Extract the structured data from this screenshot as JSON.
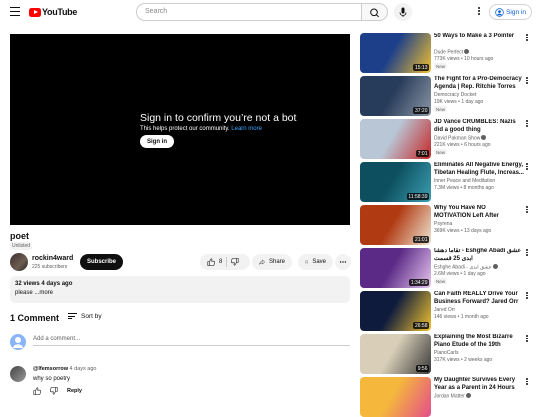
{
  "header": {
    "logo_text": "YouTube",
    "search_placeholder": "Search",
    "signin_label": "Sign in"
  },
  "player": {
    "message": "Sign in to confirm you’re not a bot",
    "sub": "This helps protect our community.",
    "learn_more": "Learn more",
    "button": "Sign in"
  },
  "video": {
    "title": "poet",
    "visibility": "Unlisted",
    "channel": "rockin4ward",
    "subscribers": "225 subscribers",
    "subscribe_label": "Subscribe",
    "likes": "8",
    "share_label": "Share",
    "save_label": "Save",
    "views_date": "32 views  4 days ago",
    "description": "please ...more"
  },
  "comments": {
    "count": "1 Comment",
    "sort_label": "Sort by",
    "add_placeholder": "Add a comment...",
    "items": [
      {
        "author": "@lfemsorrow",
        "age": "4 days ago",
        "text": "why so poetry",
        "reply_label": "Reply"
      }
    ]
  },
  "related": [
    {
      "title": "50 Ways to Make a 3 Pointer",
      "channel": "Dude Perfect",
      "meta": "773K views • 10 hours ago",
      "badge": "New",
      "duration": "15:13",
      "colors": [
        "#1d3f8a",
        "#f2c12e"
      ],
      "verified": true
    },
    {
      "title": "The Fight for a Pro-Democracy Agenda | Rep. Ritchie Torres",
      "channel": "Democracy Docket",
      "meta": "19K views • 1 day ago",
      "badge": "New",
      "duration": "37:20",
      "colors": [
        "#273c5a",
        "#8c96a5"
      ],
      "verified": false
    },
    {
      "title": "JD Vance CRUMBLES: Nazis did a good thing",
      "channel": "David Pakman Show",
      "meta": "221K views • 6 hours ago",
      "badge": "New",
      "duration": "7:01",
      "colors": [
        "#b9c6d6",
        "#c62828"
      ],
      "verified": true
    },
    {
      "title": "Eliminates All Negative Energy, Tibetan Healing Flute, Increas...",
      "channel": "Inner Peace and Meditation",
      "meta": "7.3M views • 8 months ago",
      "badge": "",
      "duration": "11:58:39",
      "colors": [
        "#0d4f5f",
        "#3b9fb2"
      ],
      "verified": false
    },
    {
      "title": "Why You Have NO MOTIVATION Left After Spiritual Awakening ...",
      "channel": "Psyrena",
      "meta": "369K views • 13 days ago",
      "badge": "",
      "duration": "21:01",
      "colors": [
        "#b03a12",
        "#f0e6d2"
      ],
      "verified": false
    },
    {
      "title": "تقاما دهشا - Eshghe Abadi عشق ابدی 25 قسمت",
      "channel": "Eshghe Abadi - عشق ابدی",
      "meta": "2.6M views • 1 day ago",
      "badge": "New",
      "duration": "1:34:29",
      "colors": [
        "#5b2a86",
        "#e7c7f0"
      ],
      "verified": true
    },
    {
      "title": "Can Faith REALLY Drive Your Business Forward? Jared Orr",
      "channel": "Jared Orr",
      "meta": "146 views • 1 month ago",
      "badge": "",
      "duration": "26:58",
      "colors": [
        "#0e1b3d",
        "#f4c430"
      ],
      "verified": false
    },
    {
      "title": "Explaining the Most Bizarre Piano Etude of the 19th Century",
      "channel": "PianoCarls",
      "meta": "317K views • 2 weeks ago",
      "badge": "",
      "duration": "9:56",
      "colors": [
        "#d9cfb8",
        "#3a3a3a"
      ],
      "verified": false
    },
    {
      "title": "My Daughter Survives Every Year as a Parent in 24 Hours",
      "channel": "Jordan Matter",
      "meta": "",
      "badge": "",
      "duration": "",
      "colors": [
        "#f5b83d",
        "#e44d8a"
      ],
      "verified": true
    }
  ]
}
